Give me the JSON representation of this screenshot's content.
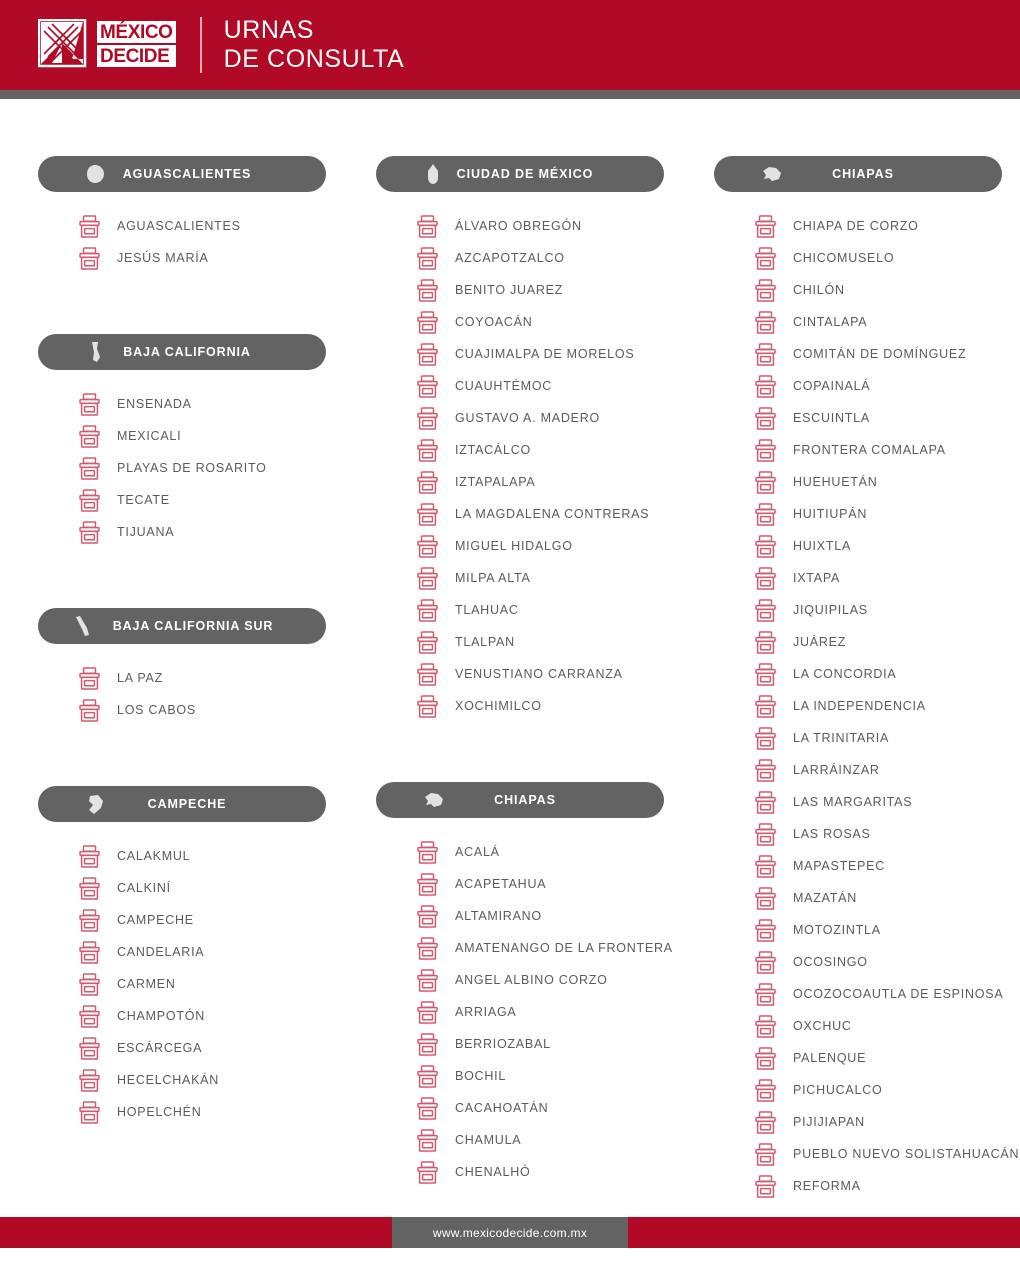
{
  "header": {
    "logo_line1": "MÉXICO",
    "logo_line2": "DECIDE",
    "logo_icon": "mexico-decide-x-logo",
    "title_line1": "URNAS",
    "title_line2": "DE CONSULTA",
    "brand_red": "#b00a26",
    "bar_gray": "#636363"
  },
  "footer": {
    "url": "www.mexicodecide.com.mx"
  },
  "columns": [
    {
      "blocks": [
        {
          "state": "AGUASCALIENTES",
          "state_icon": "state-outline-aguascalientes",
          "municipalities": [
            "AGUASCALIENTES",
            "JESÚS MARÍA"
          ]
        },
        {
          "state": "BAJA CALIFORNIA",
          "state_icon": "state-outline-baja-california",
          "municipalities": [
            "ENSENADA",
            "MEXICALI",
            "PLAYAS DE ROSARITO",
            "TECATE",
            "TIJUANA"
          ]
        },
        {
          "state": "BAJA CALIFORNIA SUR",
          "state_icon": "state-outline-baja-california-sur",
          "wide": true,
          "municipalities": [
            "LA PAZ",
            "LOS CABOS"
          ]
        },
        {
          "state": "CAMPECHE",
          "state_icon": "state-outline-campeche",
          "municipalities": [
            "CALAKMUL",
            "CALKINÍ",
            "CAMPECHE",
            "CANDELARIA",
            "CARMEN",
            "CHAMPOTÓN",
            "ESCÁRCEGA",
            "HECELCHAKÁN",
            "HOPELCHÉN"
          ]
        }
      ]
    },
    {
      "blocks": [
        {
          "state": "CIUDAD DE MÉXICO",
          "state_icon": "state-outline-ciudad-de-mexico",
          "municipalities": [
            "ÁLVARO OBREGÓN",
            "AZCAPOTZALCO",
            "BENITO JUAREZ",
            "COYOACÁN",
            "CUAJIMALPA DE MORELOS",
            "CUAUHTÉMOC",
            "GUSTAVO A. MADERO",
            "IZTACÁLCO",
            "IZTAPALAPA",
            "LA MAGDALENA CONTRERAS",
            "MIGUEL HIDALGO",
            "MILPA ALTA",
            "TLAHUAC",
            "TLALPAN",
            "VENUSTIANO CARRANZA",
            "XOCHIMILCO"
          ]
        },
        {
          "state": "CHIAPAS",
          "state_icon": "state-outline-chiapas",
          "municipalities": [
            "ACALÁ",
            "ACAPETAHUA",
            "ALTAMIRANO",
            "AMATENANGO DE LA FRONTERA",
            "ANGEL ALBINO CORZO",
            "ARRIAGA",
            "BERRIOZABAL",
            "BOCHIL",
            "CACAHOATÁN",
            "CHAMULA",
            "CHENALHÓ"
          ]
        }
      ]
    },
    {
      "blocks": [
        {
          "state": "CHIAPAS",
          "state_icon": "state-outline-chiapas",
          "municipalities": [
            "CHIAPA DE CORZO",
            "CHICOMUSELO",
            "CHILÓN",
            "CINTALAPA",
            "COMITÁN DE DOMÍNGUEZ",
            "COPAINALÁ",
            "ESCUINTLA",
            "FRONTERA COMALAPA",
            "HUEHUETÁN",
            "HUITIUPÁN",
            "HUIXTLA",
            "IXTAPA",
            "JIQUIPILAS",
            "JUÁREZ",
            "LA CONCORDIA",
            "LA INDEPENDENCIA",
            "LA TRINITARIA",
            "LARRÁINZAR",
            "LAS MARGARITAS",
            "LAS ROSAS",
            "MAPASTEPEC",
            "MAZATÁN",
            "MOTOZINTLA",
            "OCOSINGO",
            "OCOZOCOAUTLA DE ESPINOSA",
            "OXCHUC",
            "PALENQUE",
            "PICHUCALCO",
            "PIJIJIAPAN",
            "PUEBLO NUEVO SOLISTAHUACÁN",
            "REFORMA"
          ]
        }
      ]
    }
  ]
}
